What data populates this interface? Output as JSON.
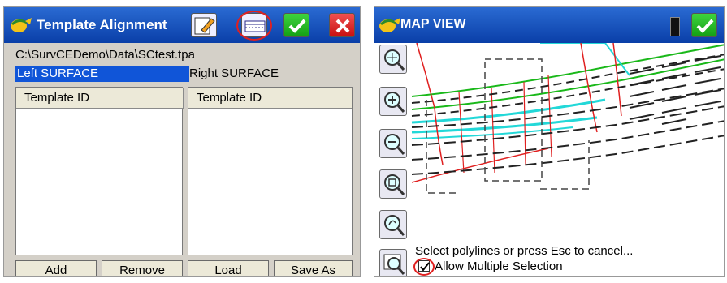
{
  "left_window": {
    "title": "Template Alignment",
    "file_path": "C:\\SurvCEDemo\\Data\\SCtest.tpa",
    "left_label": "Left SURFACE",
    "right_label": "Right SURFACE",
    "left_list": {
      "header": "Template ID",
      "items": []
    },
    "right_list": {
      "header": "Template ID",
      "items": []
    },
    "buttons": {
      "add": "Add",
      "remove": "Remove",
      "load": "Load",
      "save_as": "Save As"
    }
  },
  "right_window": {
    "title": "MAP VIEW",
    "status_text": "Select polylines or press Esc to cancel...",
    "allow_multiple_label": "Allow Multiple Selection",
    "allow_multiple_checked": true,
    "tools": [
      "zoom-extents-icon",
      "zoom-in-icon",
      "zoom-out-icon",
      "zoom-window-icon",
      "zoom-previous-icon",
      "zoom-object-icon"
    ]
  },
  "colors": {
    "titlebar": "#0a3fa8",
    "selection": "#1055d8",
    "ok_green": "#14a014",
    "close_red": "#c81010",
    "highlight_circle": "#e02020"
  }
}
